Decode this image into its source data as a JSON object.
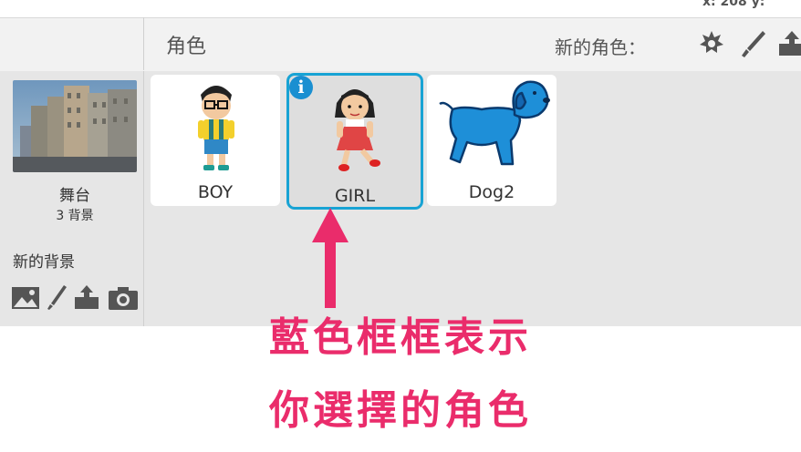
{
  "coords": {
    "text": "x: 208  y:"
  },
  "header": {
    "sprites_title": "角色",
    "new_sprite_label": "新的角色："
  },
  "stage": {
    "label": "舞台",
    "backdrop_count": "3 背景",
    "new_backdrop_label": "新的背景"
  },
  "sprites": [
    {
      "name": "BOY",
      "selected": false
    },
    {
      "name": "GIRL",
      "selected": true,
      "info_badge": "i"
    },
    {
      "name": "Dog2",
      "selected": false
    }
  ],
  "annotation": {
    "line1": "藍色框框表示",
    "line2": "你選擇的角色"
  },
  "colors": {
    "selected_border": "#18a3d4",
    "annotation": "#ea2c6b",
    "info_badge": "#1a8fd1"
  },
  "icons": [
    "sprite-library-icon",
    "paint-brush-icon",
    "upload-icon",
    "image-icon",
    "camera-icon"
  ]
}
